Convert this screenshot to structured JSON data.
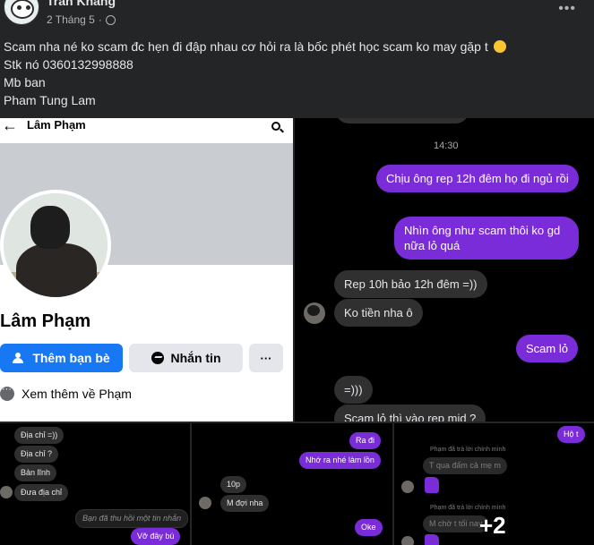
{
  "post": {
    "author": "Trần Khang",
    "date": "2 Tháng 5",
    "separator": "·",
    "caption_lines": [
      "Scam nha né ko scam đc hẹn đi đập nhau cơ hỏi ra là bốc phét học scam ko may gặp t",
      "Stk nó 0360132998888",
      "Mb ban",
      "Pham Tung Lam"
    ]
  },
  "profile_tile": {
    "top_name": "Lâm Phạm",
    "name": "Lâm Phạm",
    "add_friend_label": "Thêm bạn bè",
    "message_label": "Nhắn tin",
    "more_label": "···",
    "see_more_label": "Xem thêm về Phạm"
  },
  "chat_tile": {
    "time": "14:30",
    "messages": [
      {
        "from": "me",
        "text": "Chịu ông rep 12h đêm họ đi ngủ rồi"
      },
      {
        "from": "me",
        "text": "Nhìn ông như scam thôi ko gd nữa lỏ quá"
      },
      {
        "from": "them",
        "text": "Rep 10h bảo 12h đêm =))"
      },
      {
        "from": "them",
        "text": "Ko tiền nha ô"
      },
      {
        "from": "me",
        "text": "Scam lỏ"
      },
      {
        "from": "them",
        "text": "=)))"
      },
      {
        "from": "them",
        "text": "Scam lỏ thì vào rep mid ?"
      }
    ]
  },
  "small_chat_1": {
    "messages": [
      {
        "from": "them",
        "text": "Địa chỉ =))"
      },
      {
        "from": "them",
        "text": "Địa chỉ ?"
      },
      {
        "from": "them",
        "text": "Bản lĩnh"
      },
      {
        "from": "them",
        "text": "Đưa địa chỉ"
      },
      {
        "from": "them",
        "text": "Bạn đã thu hồi một tin nhắn"
      },
      {
        "from": "me",
        "text": "Vỡ đây bú"
      }
    ]
  },
  "small_chat_2": {
    "messages": [
      {
        "from": "me",
        "text": "Ra đi"
      },
      {
        "from": "me",
        "text": "Nhớ ra nhé làm lồn"
      },
      {
        "from": "them",
        "text": "10p"
      },
      {
        "from": "them",
        "text": "M đợi nha"
      },
      {
        "from": "me",
        "text": "Oke"
      }
    ]
  },
  "small_chat_3": {
    "messages": [
      {
        "from": "me",
        "text": "Hộ t"
      },
      {
        "from": "note",
        "text": "Phạm đã trả lời chính mình"
      },
      {
        "from": "them",
        "text": "T qua đấm cả mẹ m"
      },
      {
        "from": "note",
        "text": "Phạm đã trả lời chính mình"
      },
      {
        "from": "them",
        "text": "M chờ t tối nay"
      }
    ],
    "more_count": "+2"
  },
  "icons": [
    "globe-icon",
    "more-dots-icon",
    "back-arrow-icon",
    "search-icon",
    "add-friend-icon",
    "messenger-icon",
    "dots-icon",
    "laughing-emoji-icon",
    "like-thumb-icon"
  ],
  "colors": {
    "background": "#242526",
    "accent": "#1877f2",
    "bubble_me": "#7b2cd9",
    "bubble_them": "#303030"
  }
}
